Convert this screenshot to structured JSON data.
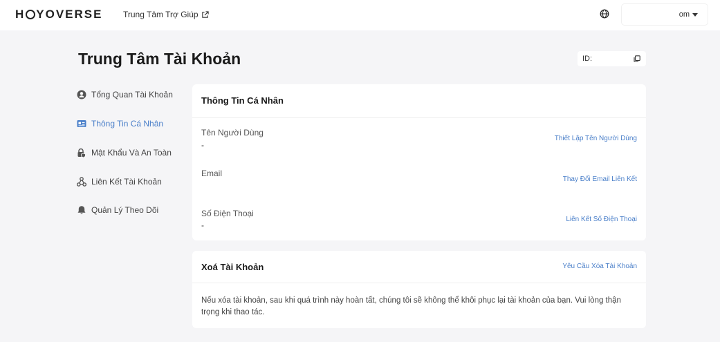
{
  "header": {
    "logo_left": "H",
    "logo_right": "YOVERSE",
    "help_label": "Trung Tâm Trợ Giúp",
    "username": "om"
  },
  "page": {
    "title": "Trung Tâm Tài Khoản",
    "id_label": "ID:"
  },
  "sidebar": {
    "items": [
      {
        "label": "Tổng Quan Tài Khoản",
        "icon": "user-circle-icon",
        "active": false
      },
      {
        "label": "Thông Tin Cá Nhân",
        "icon": "id-card-icon",
        "active": true
      },
      {
        "label": "Mật Khẩu Và An Toàn",
        "icon": "lock-shield-icon",
        "active": false
      },
      {
        "label": "Liên Kết Tài Khoản",
        "icon": "link-nodes-icon",
        "active": false
      },
      {
        "label": "Quản Lý Theo Dõi",
        "icon": "bell-icon",
        "active": false
      }
    ]
  },
  "personal_info": {
    "title": "Thông Tin Cá Nhân",
    "fields": [
      {
        "label": "Tên Người Dùng",
        "value": "-",
        "action": "Thiết Lập Tên Người Dùng"
      },
      {
        "label": "Email",
        "value": "",
        "action": "Thay Đổi Email Liên Kết"
      },
      {
        "label": "Số Điện Thoại",
        "value": "-",
        "action": "Liên Kết Số Điện Thoại"
      }
    ]
  },
  "delete_account": {
    "title": "Xoá Tài Khoản",
    "action": "Yêu Cầu Xóa Tài Khoản",
    "description": "Nếu xóa tài khoản, sau khi quá trình này hoàn tất, chúng tôi sẽ không thể khôi phục lại tài khoản của bạn. Vui lòng thận trọng khi thao tác."
  },
  "colors": {
    "accent": "#4a7fc9",
    "background": "#f5f5f7"
  }
}
